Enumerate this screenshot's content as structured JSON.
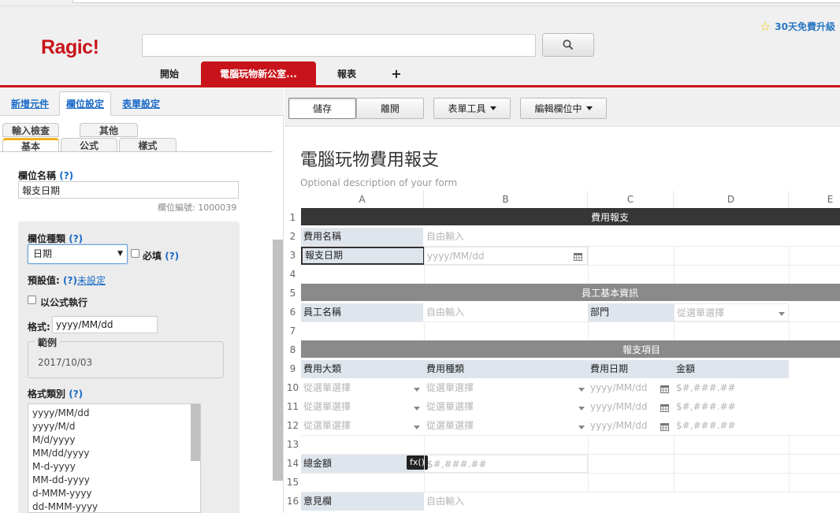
{
  "app": {
    "logo": "Ragic!",
    "upgrade_label": "30天免費升級"
  },
  "search": {
    "placeholder": ""
  },
  "nav": {
    "tabs": [
      {
        "label": "開始"
      },
      {
        "label": "電腦玩物新公室..."
      },
      {
        "label": "報表"
      },
      {
        "label": "+"
      }
    ]
  },
  "left": {
    "tabs": [
      {
        "label": "新增元件"
      },
      {
        "label": "欄位設定"
      },
      {
        "label": "表單設定"
      }
    ],
    "subtabs": {
      "row1": [
        "輸入檢查",
        "其他"
      ],
      "row2": [
        "基本",
        "公式",
        "樣式"
      ]
    },
    "field_name_label": "欄位名稱",
    "help_mark": "(?)",
    "field_name_value": "報支日期",
    "field_id_text": "欄位編號: 1000039",
    "field_type_label": "欄位種類",
    "field_type_value": "日期",
    "required_label": "必填",
    "default_label": "預設值:",
    "default_link": "未設定",
    "formula_exec_label": "以公式執行",
    "format_label": "格式:",
    "format_value": "yyyy/MM/dd",
    "example_legend": "範例",
    "example_value": "2017/10/03",
    "format_type_label": "格式類別",
    "format_options": [
      "yyyy/MM/dd",
      "yyyy/M/d",
      "M/d/yyyy",
      "MM/dd/yyyy",
      "M-d-yyyy",
      "MM-dd-yyyy",
      "d-MMM-yyyy",
      "dd-MMM-yyyy"
    ]
  },
  "toolbar": {
    "save": "儲存",
    "close": "離開",
    "form_tools": "表單工具",
    "edit_mode": "編輯欄位中"
  },
  "form": {
    "title": "電腦玩物費用報支",
    "description": "Optional description of your form",
    "columns": [
      "A",
      "B",
      "C",
      "D",
      "E"
    ],
    "rows": [
      "1",
      "2",
      "3",
      "4",
      "5",
      "6",
      "7",
      "8",
      "9",
      "10",
      "11",
      "12",
      "13",
      "14",
      "15",
      "16"
    ],
    "section1": "費用報支",
    "section2": "員工基本資訊",
    "section3": "報支項目",
    "expense_name_label": "費用名稱",
    "report_date_label": "報支日期",
    "employee_name_label": "員工名稱",
    "department_label": "部門",
    "category_label": "費用大類",
    "type_label": "費用種類",
    "date_label": "費用日期",
    "amount_label": "金額",
    "total_label": "總金額",
    "remarks_label": "意見欄",
    "free_input": "自由輸入",
    "date_ph": "yyyy/MM/dd",
    "select_ph": "從選單選擇",
    "money_ph": "$#,###.##",
    "fx": "fx()"
  }
}
